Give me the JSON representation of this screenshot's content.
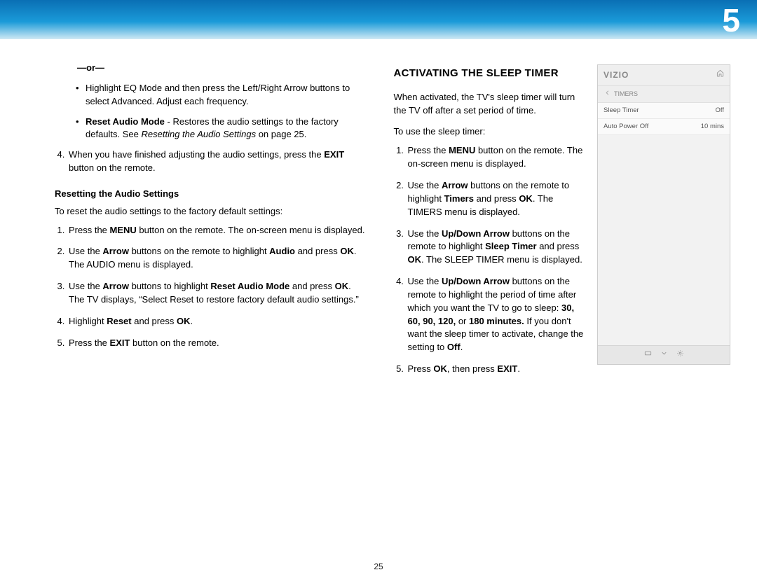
{
  "page_number_header": "5",
  "page_number_footer": "25",
  "left": {
    "or_label": "—or—",
    "eq_bullet": "Highlight EQ Mode and then press the Left/Right Arrow buttons to select Advanced. Adjust each frequency.",
    "reset_bullet_bold": "Reset Audio Mode",
    "reset_bullet_rest": " - Restores the audio settings to the factory defaults. See ",
    "reset_bullet_italic": "Resetting the Audio Settings",
    "reset_bullet_tail": " on page 25.",
    "step4a": "When you have finished adjusting the audio settings, press the ",
    "step4b": "EXIT",
    "step4c": " button on the remote.",
    "sub_heading": "Resetting the Audio Settings",
    "sub_intro": "To reset the audio settings to the factory default settings:",
    "r1a": "Press the ",
    "r1b": "MENU",
    "r1c": " button on the remote. The on-screen menu is displayed.",
    "r2a": "Use the ",
    "r2b": "Arrow",
    "r2c": " buttons on the remote to highlight ",
    "r2d": "Audio",
    "r2e": " and press ",
    "r2f": "OK",
    "r2g": ". The AUDIO menu is displayed.",
    "r3a": "Use the ",
    "r3b": "Arrow",
    "r3c": " buttons to highlight ",
    "r3d": "Reset Audio Mode",
    "r3e": " and press ",
    "r3f": "OK",
    "r3g": ". The TV displays, “Select Reset to restore factory default audio settings.”",
    "r4a": "Highlight ",
    "r4b": "Reset",
    "r4c": " and press ",
    "r4d": "OK",
    "r4e": ".",
    "r5a": "Press the ",
    "r5b": "EXIT",
    "r5c": " button on the remote."
  },
  "right": {
    "heading": "ACTIVATING THE SLEEP TIMER",
    "intro": "When activated, the TV's sleep timer will turn the TV off after a set period of time.",
    "lead": "To use the sleep timer:",
    "s1a": "Press the ",
    "s1b": "MENU",
    "s1c": " button on the remote. The on-screen menu is displayed.",
    "s2a": "Use the ",
    "s2b": "Arrow",
    "s2c": " buttons on the remote to highlight ",
    "s2d": "Timers",
    "s2e": " and press ",
    "s2f": "OK",
    "s2g": ". The TIMERS menu is displayed.",
    "s3a": "Use the ",
    "s3b": "Up/Down Arrow",
    "s3c": " buttons on the remote to highlight ",
    "s3d": "Sleep Timer",
    "s3e": " and press ",
    "s3f": "OK",
    "s3g": ". The SLEEP TIMER menu is displayed.",
    "s4a": "Use the ",
    "s4b": "Up/Down Arrow",
    "s4c": " buttons on the remote to highlight the period of time after which you want the TV to go to sleep: ",
    "s4d": "30, 60, 90, 120,",
    "s4e": " or ",
    "s4f": "180 minutes.",
    "s4g": " If you don't want the sleep timer to activate, change the setting to ",
    "s4h": "Off",
    "s4i": ".",
    "s5a": "Press ",
    "s5b": "OK",
    "s5c": ", then press ",
    "s5d": "EXIT",
    "s5e": "."
  },
  "tv": {
    "logo": "VIZIO",
    "crumb": "TIMERS",
    "rows": [
      {
        "label": "Sleep Timer",
        "value": "Off"
      },
      {
        "label": "Auto Power Off",
        "value": "10 mins"
      }
    ]
  }
}
